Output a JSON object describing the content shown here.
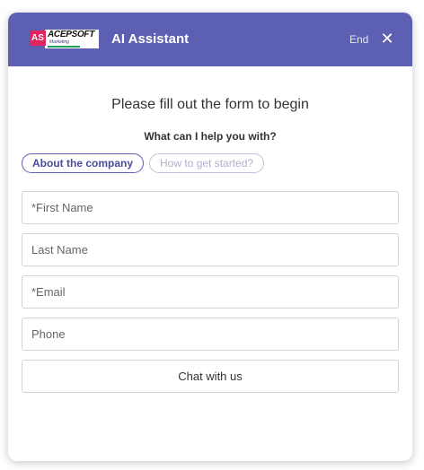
{
  "header": {
    "logo": {
      "badge": "AS",
      "name": "ACEPSOFT",
      "sub": "Marketing"
    },
    "title": "AI Assistant",
    "end_label": "End",
    "close_glyph": "✕",
    "background": "#5d5fb2"
  },
  "form": {
    "heading": "Please fill out the form to begin",
    "question": "What can I help you with?",
    "topics": [
      {
        "label": "About the company",
        "selected": true
      },
      {
        "label": "How to get started?",
        "selected": false
      }
    ],
    "fields": {
      "first_name": {
        "placeholder": "*First Name",
        "value": ""
      },
      "last_name": {
        "placeholder": "Last Name",
        "value": ""
      },
      "email": {
        "placeholder": "*Email",
        "value": ""
      },
      "phone": {
        "placeholder": "Phone",
        "value": ""
      }
    },
    "submit_label": "Chat with us"
  },
  "colors": {
    "accent": "#5d5fb2",
    "logo_badge": "#e0245e",
    "inactive_chip": "#b0b0cc"
  }
}
